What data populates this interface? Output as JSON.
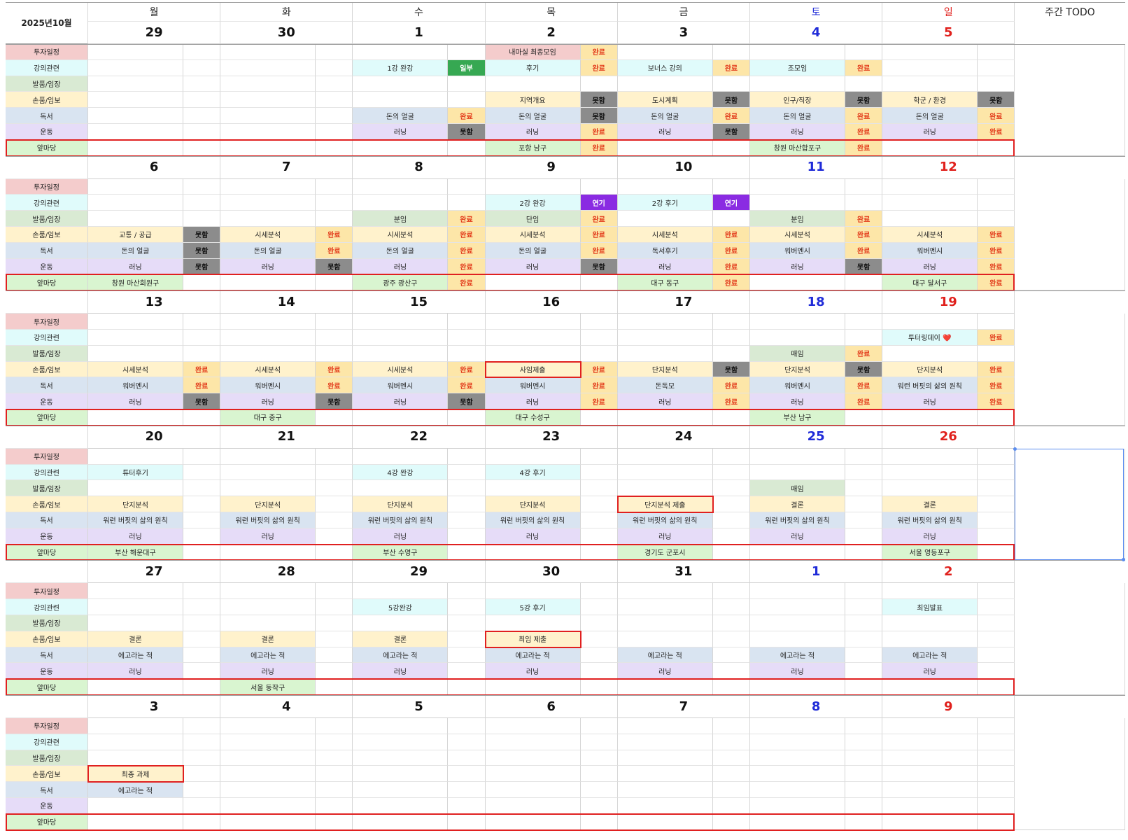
{
  "month_label": "2025년10월",
  "todo_header": "주간 TODO",
  "weekdays": [
    "월",
    "화",
    "수",
    "목",
    "금",
    "토",
    "일"
  ],
  "colors": {
    "day_normal": "#111111",
    "day_sat": "#1f2bd8",
    "day_sun": "#e0201c",
    "status_done_bg": "#fde6a8",
    "status_done_fg": "#e23a1a",
    "status_fail_bg": "#8c8c8c",
    "status_fail_fg": "#111111",
    "status_partial_bg": "#36a852",
    "status_partial_fg": "#ffffff",
    "status_postpone_bg": "#8a2be2",
    "status_postpone_fg": "#ffffff",
    "highlight": "#e02020"
  },
  "categories": [
    {
      "name": "투자일정",
      "bg": "#f4cccc"
    },
    {
      "name": "강의관련",
      "bg": "#e0fbfb"
    },
    {
      "name": "발품/임장",
      "bg": "#d9ead3"
    },
    {
      "name": "손품/임보",
      "bg": "#fff2cc"
    },
    {
      "name": "독서",
      "bg": "#d9e4f1"
    },
    {
      "name": "운동",
      "bg": "#e6dcf8"
    },
    {
      "name": "앞마당",
      "bg": "#d9f5d0"
    }
  ],
  "weeks": [
    {
      "days": [
        "29",
        "30",
        "1",
        "2",
        "3",
        "4",
        "5"
      ],
      "entries": [
        [
          0,
          3,
          "내마실 최종모임",
          "완료"
        ],
        [
          1,
          2,
          "1강 완강",
          "일부"
        ],
        [
          1,
          3,
          "후기",
          "완료"
        ],
        [
          1,
          4,
          "보너스 강의",
          "완료"
        ],
        [
          1,
          5,
          "조모임",
          "완료"
        ],
        [
          3,
          3,
          "지역개요",
          "못함"
        ],
        [
          3,
          4,
          "도시계획",
          "못함"
        ],
        [
          3,
          5,
          "인구/직장",
          "못함"
        ],
        [
          3,
          6,
          "학군 / 환경",
          "못함"
        ],
        [
          4,
          2,
          "돈의 얼굴",
          "완료"
        ],
        [
          4,
          3,
          "돈의 얼굴",
          "못함"
        ],
        [
          4,
          4,
          "돈의 얼굴",
          "완료"
        ],
        [
          4,
          5,
          "돈의 얼굴",
          "완료"
        ],
        [
          4,
          6,
          "돈의 얼굴",
          "완료"
        ],
        [
          5,
          2,
          "러닝",
          "못함"
        ],
        [
          5,
          3,
          "러닝",
          "완료"
        ],
        [
          5,
          4,
          "러닝",
          "못함"
        ],
        [
          5,
          5,
          "러닝",
          "완료"
        ],
        [
          5,
          6,
          "러닝",
          "완료"
        ],
        [
          6,
          3,
          "포항 남구",
          "완료"
        ],
        [
          6,
          5,
          "창원 마산합포구",
          "완료"
        ]
      ],
      "highlights": []
    },
    {
      "days": [
        "6",
        "7",
        "8",
        "9",
        "10",
        "11",
        "12"
      ],
      "entries": [
        [
          1,
          3,
          "2강 완강",
          "연기"
        ],
        [
          1,
          4,
          "2강 후기",
          "연기"
        ],
        [
          2,
          2,
          "분임",
          "완료"
        ],
        [
          2,
          3,
          "단임",
          "완료"
        ],
        [
          2,
          5,
          "분임",
          "완료"
        ],
        [
          3,
          0,
          "교통 / 공급",
          "못함"
        ],
        [
          3,
          1,
          "시세분석",
          "완료"
        ],
        [
          3,
          2,
          "시세분석",
          "완료"
        ],
        [
          3,
          3,
          "시세분석",
          "완료"
        ],
        [
          3,
          4,
          "시세분석",
          "완료"
        ],
        [
          3,
          5,
          "시세분석",
          "완료"
        ],
        [
          3,
          6,
          "시세분석",
          "완료"
        ],
        [
          4,
          0,
          "돈의 얼굴",
          "못함"
        ],
        [
          4,
          1,
          "돈의 얼굴",
          "완료"
        ],
        [
          4,
          2,
          "돈의 얼굴",
          "완료"
        ],
        [
          4,
          3,
          "돈의 얼굴",
          "완료"
        ],
        [
          4,
          4,
          "독서후기",
          "완료"
        ],
        [
          4,
          5,
          "워버멘시",
          "완료"
        ],
        [
          4,
          6,
          "워버멘시",
          "완료"
        ],
        [
          5,
          0,
          "러닝",
          "못함"
        ],
        [
          5,
          1,
          "러닝",
          "못함"
        ],
        [
          5,
          2,
          "러닝",
          "완료"
        ],
        [
          5,
          3,
          "러닝",
          "못함"
        ],
        [
          5,
          4,
          "러닝",
          "완료"
        ],
        [
          5,
          5,
          "러닝",
          "못함"
        ],
        [
          5,
          6,
          "러닝",
          "완료"
        ],
        [
          6,
          0,
          "창원 마산회원구",
          ""
        ],
        [
          6,
          2,
          "광주 광산구",
          "완료"
        ],
        [
          6,
          4,
          "대구 동구",
          "완료"
        ],
        [
          6,
          6,
          "대구 달서구",
          "완료"
        ]
      ],
      "highlights": []
    },
    {
      "days": [
        "13",
        "14",
        "15",
        "16",
        "17",
        "18",
        "19"
      ],
      "entries": [
        [
          1,
          6,
          "투터링데이 ❤️",
          "완료"
        ],
        [
          2,
          5,
          "매임",
          "완료"
        ],
        [
          3,
          0,
          "시세분석",
          "완료"
        ],
        [
          3,
          1,
          "시세분석",
          "완료"
        ],
        [
          3,
          2,
          "시세분석",
          "완료"
        ],
        [
          3,
          3,
          "사임제출",
          "완료"
        ],
        [
          3,
          4,
          "단지분석",
          "못함"
        ],
        [
          3,
          5,
          "단지분석",
          "못함"
        ],
        [
          3,
          6,
          "단지분석",
          "완료"
        ],
        [
          4,
          0,
          "워버멘시",
          "완료"
        ],
        [
          4,
          1,
          "워버멘시",
          "완료"
        ],
        [
          4,
          2,
          "워버멘시",
          "완료"
        ],
        [
          4,
          3,
          "워버멘시",
          "완료"
        ],
        [
          4,
          4,
          "돈독모",
          "완료"
        ],
        [
          4,
          5,
          "워버멘시",
          "완료"
        ],
        [
          4,
          6,
          "워런 버핏의 삶의 원칙",
          "완료"
        ],
        [
          5,
          0,
          "러닝",
          "못함"
        ],
        [
          5,
          1,
          "러닝",
          "못함"
        ],
        [
          5,
          2,
          "러닝",
          "못함"
        ],
        [
          5,
          3,
          "러닝",
          "완료"
        ],
        [
          5,
          4,
          "러닝",
          "완료"
        ],
        [
          5,
          5,
          "러닝",
          "완료"
        ],
        [
          5,
          6,
          "러닝",
          "완료"
        ],
        [
          6,
          1,
          "대구 중구",
          ""
        ],
        [
          6,
          3,
          "대구 수성구",
          ""
        ],
        [
          6,
          5,
          "부산 남구",
          ""
        ]
      ],
      "highlights": [
        [
          3,
          3
        ]
      ]
    },
    {
      "days": [
        "20",
        "21",
        "22",
        "23",
        "24",
        "25",
        "26"
      ],
      "entries": [
        [
          1,
          0,
          "튜터후기",
          ""
        ],
        [
          1,
          2,
          "4강 완강",
          ""
        ],
        [
          1,
          3,
          "4강 후기",
          ""
        ],
        [
          2,
          5,
          "매임",
          ""
        ],
        [
          3,
          0,
          "단지분석",
          ""
        ],
        [
          3,
          1,
          "단지분석",
          ""
        ],
        [
          3,
          2,
          "단지분석",
          ""
        ],
        [
          3,
          3,
          "단지분석",
          ""
        ],
        [
          3,
          4,
          "단지분석 제출",
          ""
        ],
        [
          3,
          5,
          "결론",
          ""
        ],
        [
          3,
          6,
          "결론",
          ""
        ],
        [
          4,
          0,
          "워런 버핏의 삶의 원칙",
          ""
        ],
        [
          4,
          1,
          "워런 버핏의 삶의 원칙",
          ""
        ],
        [
          4,
          2,
          "워런 버핏의 삶의 원칙",
          ""
        ],
        [
          4,
          3,
          "워런 버핏의 삶의 원칙",
          ""
        ],
        [
          4,
          4,
          "워런 버핏의 삶의 원칙",
          ""
        ],
        [
          4,
          5,
          "워런 버핏의 삶의 원칙",
          ""
        ],
        [
          4,
          6,
          "워런 버핏의 삶의 원칙",
          ""
        ],
        [
          5,
          0,
          "러닝",
          ""
        ],
        [
          5,
          1,
          "러닝",
          ""
        ],
        [
          5,
          2,
          "러닝",
          ""
        ],
        [
          5,
          3,
          "러닝",
          ""
        ],
        [
          5,
          4,
          "러닝",
          ""
        ],
        [
          5,
          5,
          "러닝",
          ""
        ],
        [
          5,
          6,
          "러닝",
          ""
        ],
        [
          6,
          0,
          "부산 해운대구",
          ""
        ],
        [
          6,
          2,
          "부산 수영구",
          ""
        ],
        [
          6,
          4,
          "경기도 군포시",
          ""
        ],
        [
          6,
          6,
          "서울 영등포구",
          ""
        ]
      ],
      "highlights": [
        [
          3,
          4
        ]
      ]
    },
    {
      "days": [
        "27",
        "28",
        "29",
        "30",
        "31",
        "1",
        "2"
      ],
      "entries": [
        [
          1,
          2,
          "5강완강",
          ""
        ],
        [
          1,
          3,
          "5강 후기",
          ""
        ],
        [
          1,
          6,
          "최임발표",
          ""
        ],
        [
          3,
          0,
          "결론",
          ""
        ],
        [
          3,
          1,
          "결론",
          ""
        ],
        [
          3,
          2,
          "결론",
          ""
        ],
        [
          3,
          3,
          "최임 제출",
          ""
        ],
        [
          4,
          0,
          "에고라는 적",
          ""
        ],
        [
          4,
          1,
          "에고라는 적",
          ""
        ],
        [
          4,
          2,
          "에고라는 적",
          ""
        ],
        [
          4,
          3,
          "에고라는 적",
          ""
        ],
        [
          4,
          4,
          "에고라는 적",
          ""
        ],
        [
          4,
          5,
          "에고라는 적",
          ""
        ],
        [
          4,
          6,
          "에고라는 적",
          ""
        ],
        [
          5,
          0,
          "러닝",
          ""
        ],
        [
          5,
          1,
          "러닝",
          ""
        ],
        [
          5,
          2,
          "러닝",
          ""
        ],
        [
          5,
          3,
          "러닝",
          ""
        ],
        [
          5,
          4,
          "러닝",
          ""
        ],
        [
          5,
          5,
          "러닝",
          ""
        ],
        [
          5,
          6,
          "러닝",
          ""
        ],
        [
          6,
          1,
          "서울 동작구",
          ""
        ]
      ],
      "highlights": [
        [
          3,
          3
        ]
      ]
    },
    {
      "days": [
        "3",
        "4",
        "5",
        "6",
        "7",
        "8",
        "9"
      ],
      "entries": [
        [
          3,
          0,
          "최종 과제",
          ""
        ],
        [
          4,
          0,
          "에고라는 적",
          ""
        ]
      ],
      "highlights": [
        [
          3,
          0
        ]
      ]
    }
  ]
}
